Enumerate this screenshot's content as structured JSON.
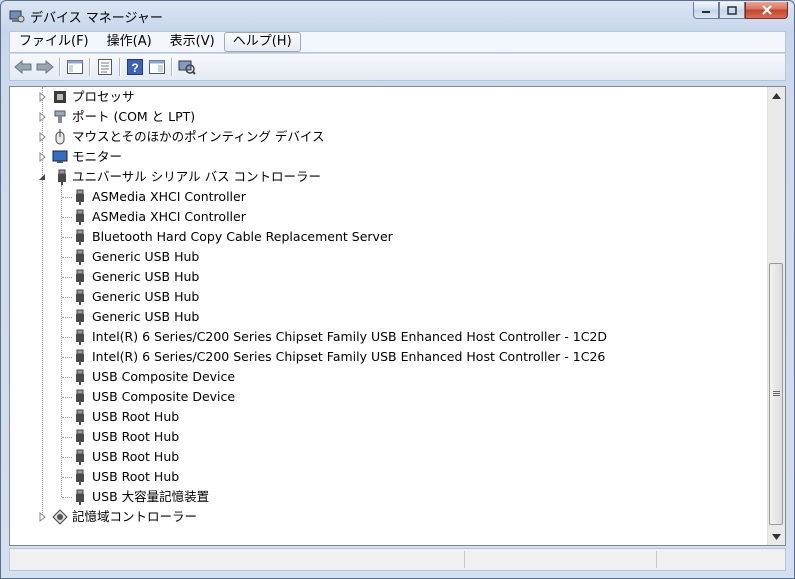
{
  "window": {
    "title": "デバイス マネージャー"
  },
  "menu": [
    {
      "label": "ファイル(F)"
    },
    {
      "label": "操作(A)"
    },
    {
      "label": "表示(V)"
    },
    {
      "label": "ヘルプ(H)"
    }
  ],
  "toolbar": {
    "buttons": [
      "back-icon",
      "forward-icon",
      "show-hide-console-tree-icon",
      "properties-icon",
      "help-icon",
      "action-pane-icon",
      "scan-hardware-icon"
    ]
  },
  "tree": {
    "categories_above": [
      {
        "label": "プロセッサ",
        "icon": "processor-icon"
      },
      {
        "label": "ポート (COM と LPT)",
        "icon": "port-icon"
      },
      {
        "label": "マウスとそのほかのポインティング デバイス",
        "icon": "mouse-icon"
      },
      {
        "label": "モニター",
        "icon": "monitor-icon"
      }
    ],
    "expanded": {
      "label": "ユニバーサル シリアル バス コントローラー",
      "icon": "usb-icon",
      "children": [
        "ASMedia XHCI Controller",
        "ASMedia XHCI Controller",
        "Bluetooth Hard Copy Cable Replacement Server",
        "Generic USB Hub",
        "Generic USB Hub",
        "Generic USB Hub",
        "Generic USB Hub",
        "Intel(R) 6 Series/C200 Series Chipset Family USB Enhanced Host Controller - 1C2D",
        "Intel(R) 6 Series/C200 Series Chipset Family USB Enhanced Host Controller - 1C26",
        "USB Composite Device",
        "USB Composite Device",
        "USB Root Hub",
        "USB Root Hub",
        "USB Root Hub",
        "USB Root Hub",
        "USB 大容量記憶装置"
      ]
    },
    "categories_below": [
      {
        "label": "記憶域コントローラー",
        "icon": "storage-controller-icon"
      }
    ]
  }
}
